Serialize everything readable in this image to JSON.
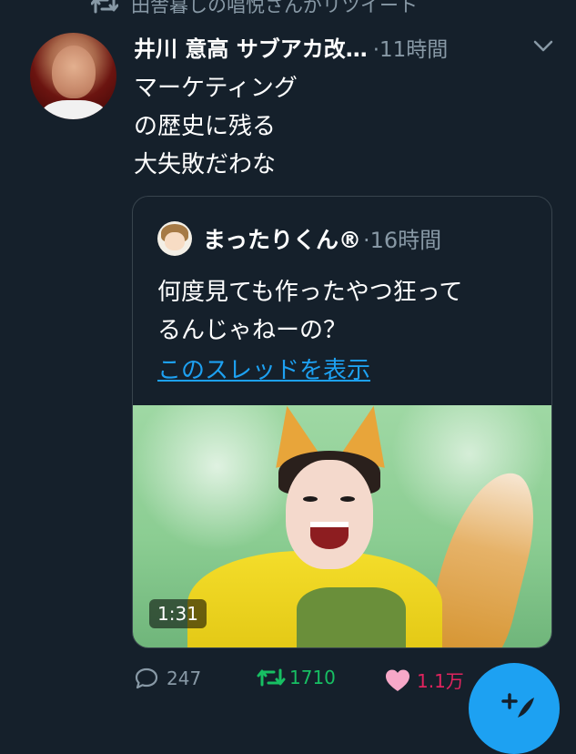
{
  "retweet": {
    "text": "田舎暮しの唱悦さんがリツイート",
    "icon": "retweet-icon"
  },
  "tweet": {
    "author": "井川 意高 サブアカ改…",
    "time": "·11時間",
    "lines": [
      "マーケティング",
      "の歴史に残る",
      "大失敗だわな"
    ]
  },
  "quote": {
    "author": "まったりくん®",
    "time": "·16時間",
    "lines": [
      "何度見ても作ったやつ狂って",
      "るんじゃねーの？"
    ],
    "thread_link": "このスレッドを表示",
    "video_duration": "1:31"
  },
  "actions": {
    "replies": "247",
    "retweets": "1710",
    "likes": "1.1万"
  },
  "colors": {
    "background": "#15202b",
    "accent": "#1da1f2",
    "retweet_green": "#17bf63",
    "like_pink": "#e0245e",
    "muted": "#8899a6"
  }
}
